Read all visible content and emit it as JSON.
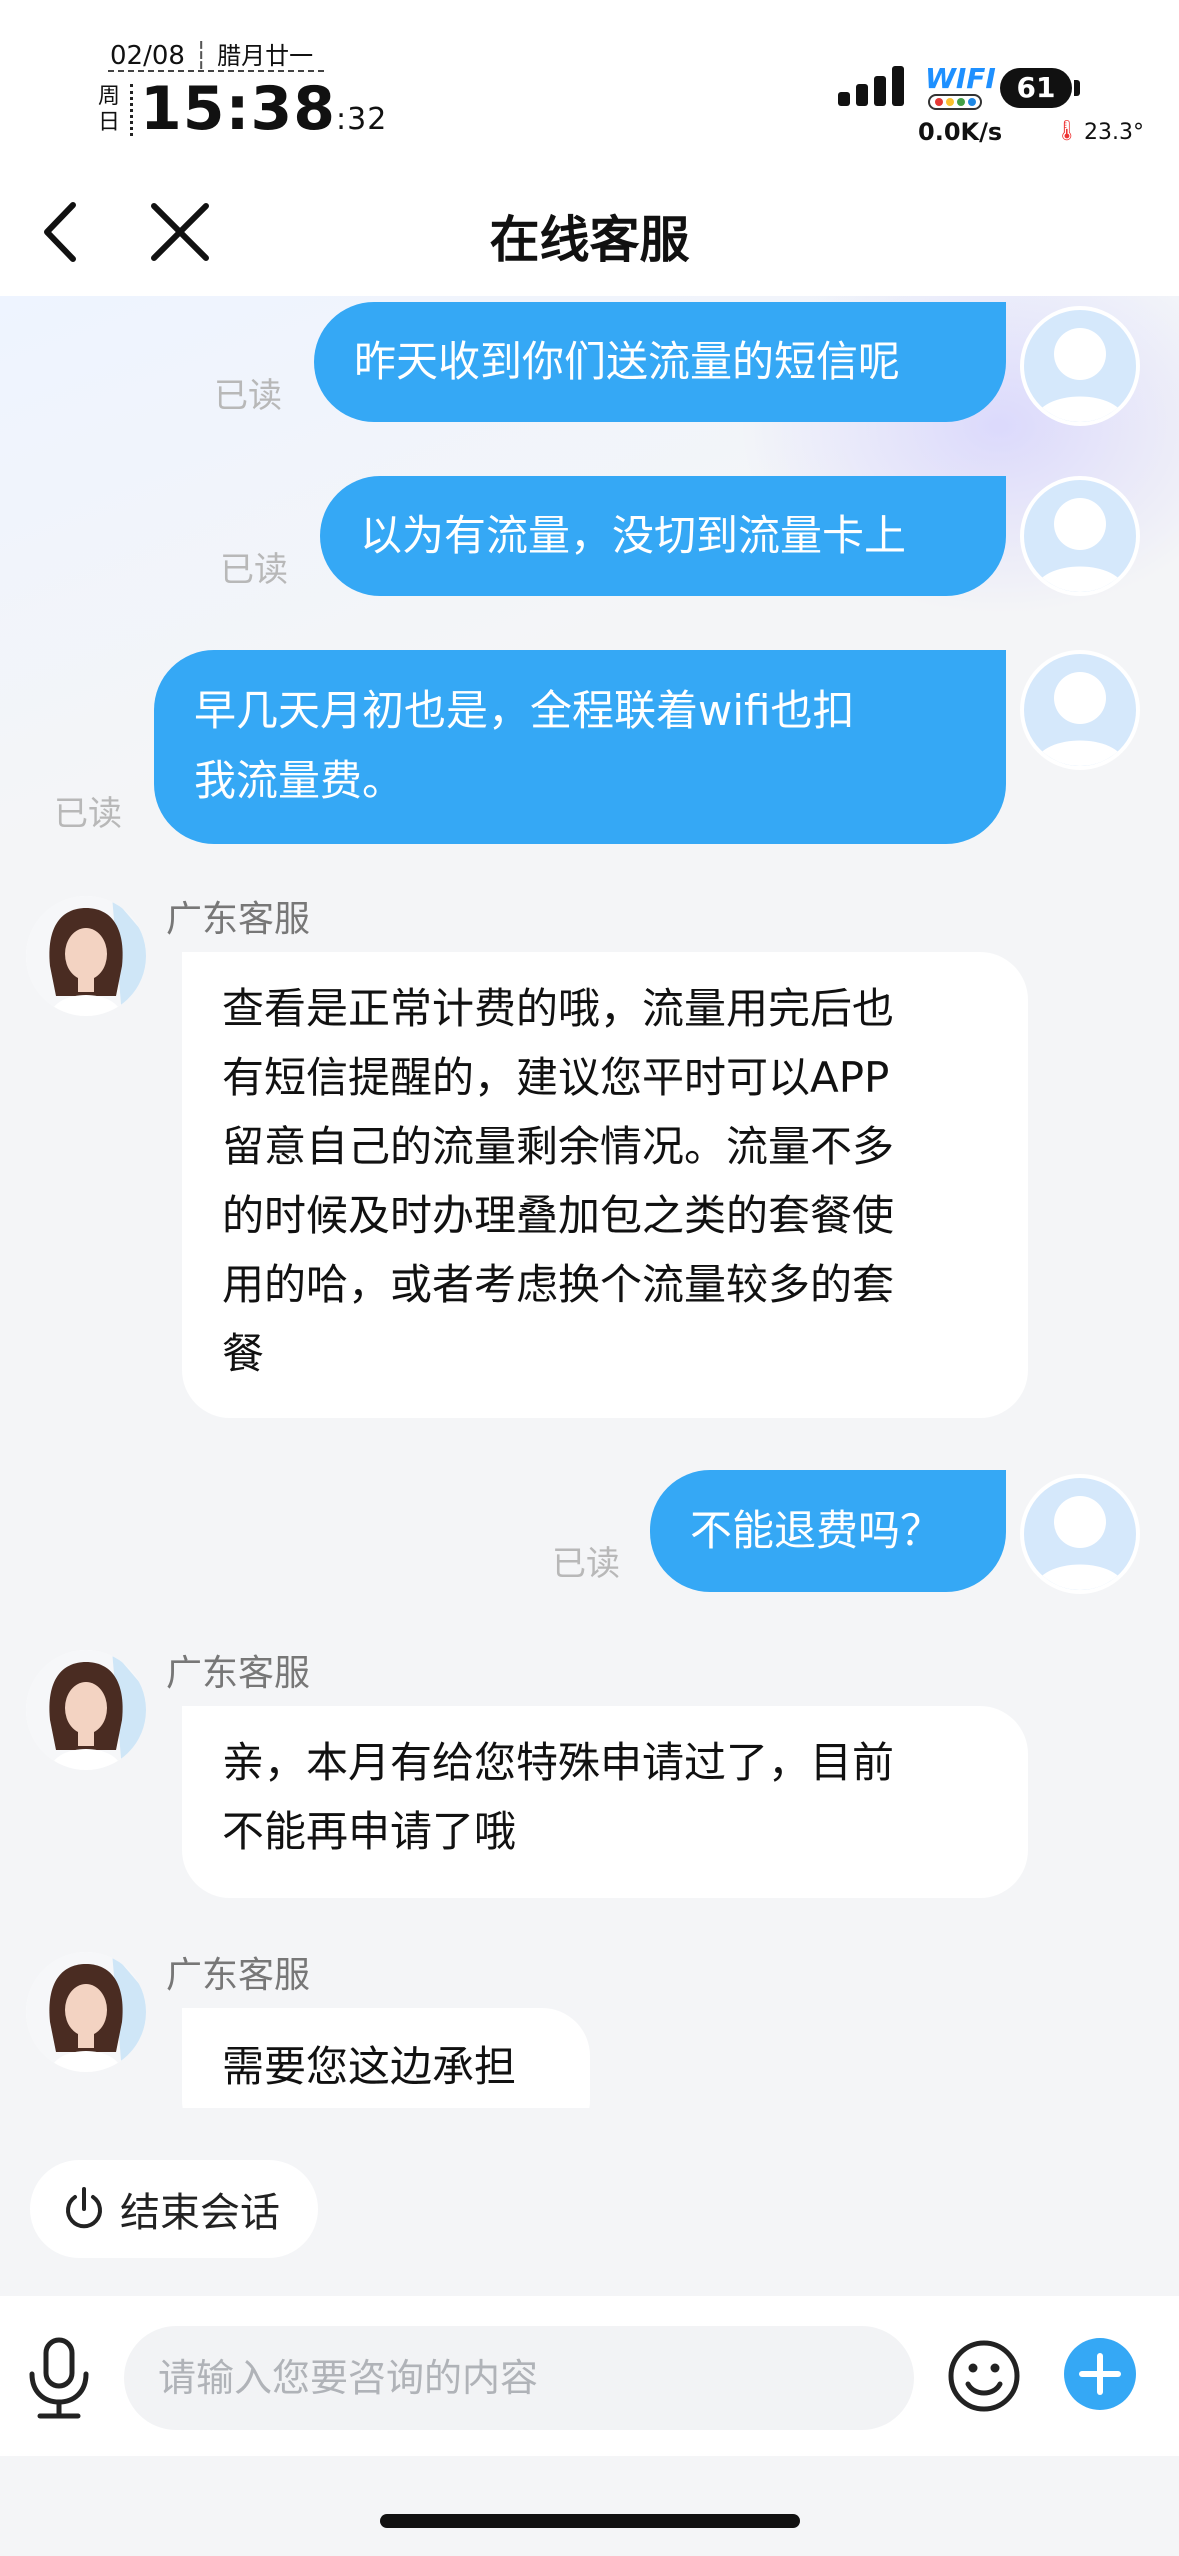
{
  "status_bar": {
    "date": "02/08",
    "lunar": "腊月廿一",
    "weekday": "周日",
    "time": "15:38",
    "seconds": ":32",
    "wifi_label": "WIFI",
    "battery": "61",
    "net_speed": "0.0K/s",
    "temperature": "23.3°"
  },
  "header": {
    "title": "在线客服",
    "back_icon": "chevron-left-icon",
    "close_icon": "close-icon"
  },
  "messages": [
    {
      "from": "user",
      "text": "昨天收到你们送流量的短信呢",
      "status": "已读"
    },
    {
      "from": "user",
      "text": "以为有流量，没切到流量卡上",
      "status": "已读"
    },
    {
      "from": "user",
      "lines": [
        "早几天月初也是，全程联着wifi也扣",
        "我流量费。"
      ],
      "status": "已读"
    },
    {
      "from": "agent",
      "name": "广东客服",
      "lines": [
        "查看是正常计费的哦，流量用完后也",
        "有短信提醒的，建议您平时可以APP",
        "留意自己的流量剩余情况。流量不多",
        "的时候及时办理叠加包之类的套餐使",
        "用的哈，或者考虑换个流量较多的套",
        "餐"
      ]
    },
    {
      "from": "user",
      "text": "不能退费吗？",
      "status": "已读"
    },
    {
      "from": "agent",
      "name": "广东客服",
      "lines": [
        "亲，本月有给您特殊申请过了，目前",
        "不能再申请了哦"
      ]
    },
    {
      "from": "agent",
      "name": "广东客服",
      "text": "需要您这边承担"
    }
  ],
  "end_session": {
    "label": "结束会话",
    "icon": "power-icon"
  },
  "input": {
    "placeholder": "请输入您要咨询的内容",
    "voice_icon": "microphone-icon",
    "emoji_icon": "emoji-icon",
    "plus_icon": "plus-icon"
  },
  "colors": {
    "accent": "#35a8f5",
    "user_bubble": "#35a8f5",
    "agent_bubble": "#ffffff",
    "background": "#f4f5f7"
  }
}
